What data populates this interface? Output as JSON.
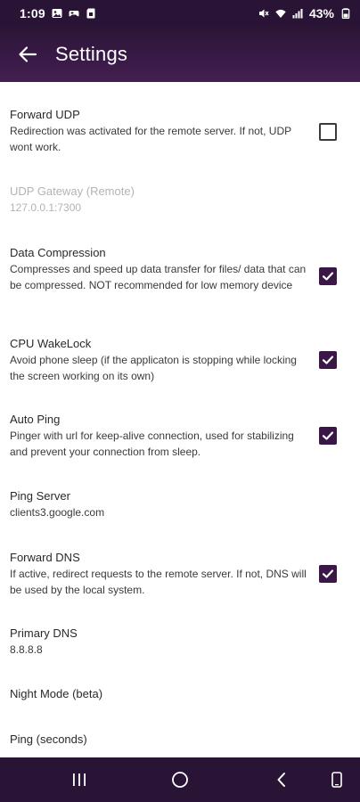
{
  "status_bar": {
    "time": "1:09",
    "battery_percent": "43%",
    "left_icons": [
      "gallery-icon",
      "gamepad-icon",
      "sd-card-icon"
    ],
    "right_icons": [
      "mute-icon",
      "wifi-icon",
      "signal-icon",
      "battery-icon"
    ]
  },
  "app_bar": {
    "title": "Settings",
    "back_icon": "arrow-left-icon"
  },
  "colors": {
    "app_bar": "#3a1a48",
    "status_bar": "#2a1435",
    "checkbox_checked": "#3a1747",
    "disabled_text": "#b3b3b3"
  },
  "preferences": [
    {
      "title": "Forward UDP",
      "summary": "Redirection was activated for the remote server. If not, UDP wont work.",
      "checkbox": true,
      "checked": false,
      "enabled": true
    },
    {
      "title": "UDP Gateway (Remote)",
      "summary": "127.0.0.1:7300",
      "checkbox": false,
      "enabled": false
    },
    {
      "title": "Data Compression",
      "summary": "Compresses and speed up data transfer for files/ data that can be compressed. NOT recommended for low memory device",
      "checkbox": true,
      "checked": true,
      "enabled": true
    },
    {
      "title": "CPU WakeLock",
      "summary": "Avoid phone sleep (if the applicaton is stopping while locking the screen working on its own)",
      "checkbox": true,
      "checked": true,
      "enabled": true
    },
    {
      "title": "Auto Ping",
      "summary": "Pinger with url for keep-alive connection, used for stabilizing and prevent your connection from sleep.",
      "checkbox": true,
      "checked": true,
      "enabled": true
    },
    {
      "title": "Ping Server",
      "summary": "clients3.google.com",
      "checkbox": false,
      "enabled": true
    },
    {
      "title": "Forward DNS",
      "summary": "If active, redirect requests to the remote server. If not, DNS will be used by the local system.",
      "checkbox": true,
      "checked": true,
      "enabled": true
    },
    {
      "title": "Primary DNS",
      "summary": "8.8.8.8",
      "checkbox": false,
      "enabled": true
    },
    {
      "title": "Night Mode (beta)",
      "summary": "",
      "checkbox": false,
      "enabled": true
    },
    {
      "title": "Ping (seconds)",
      "summary": "",
      "checkbox": false,
      "enabled": true
    }
  ],
  "nav_bar": {
    "buttons": [
      "recent-apps-icon",
      "home-icon",
      "back-icon",
      "rotate-screen-icon"
    ]
  }
}
